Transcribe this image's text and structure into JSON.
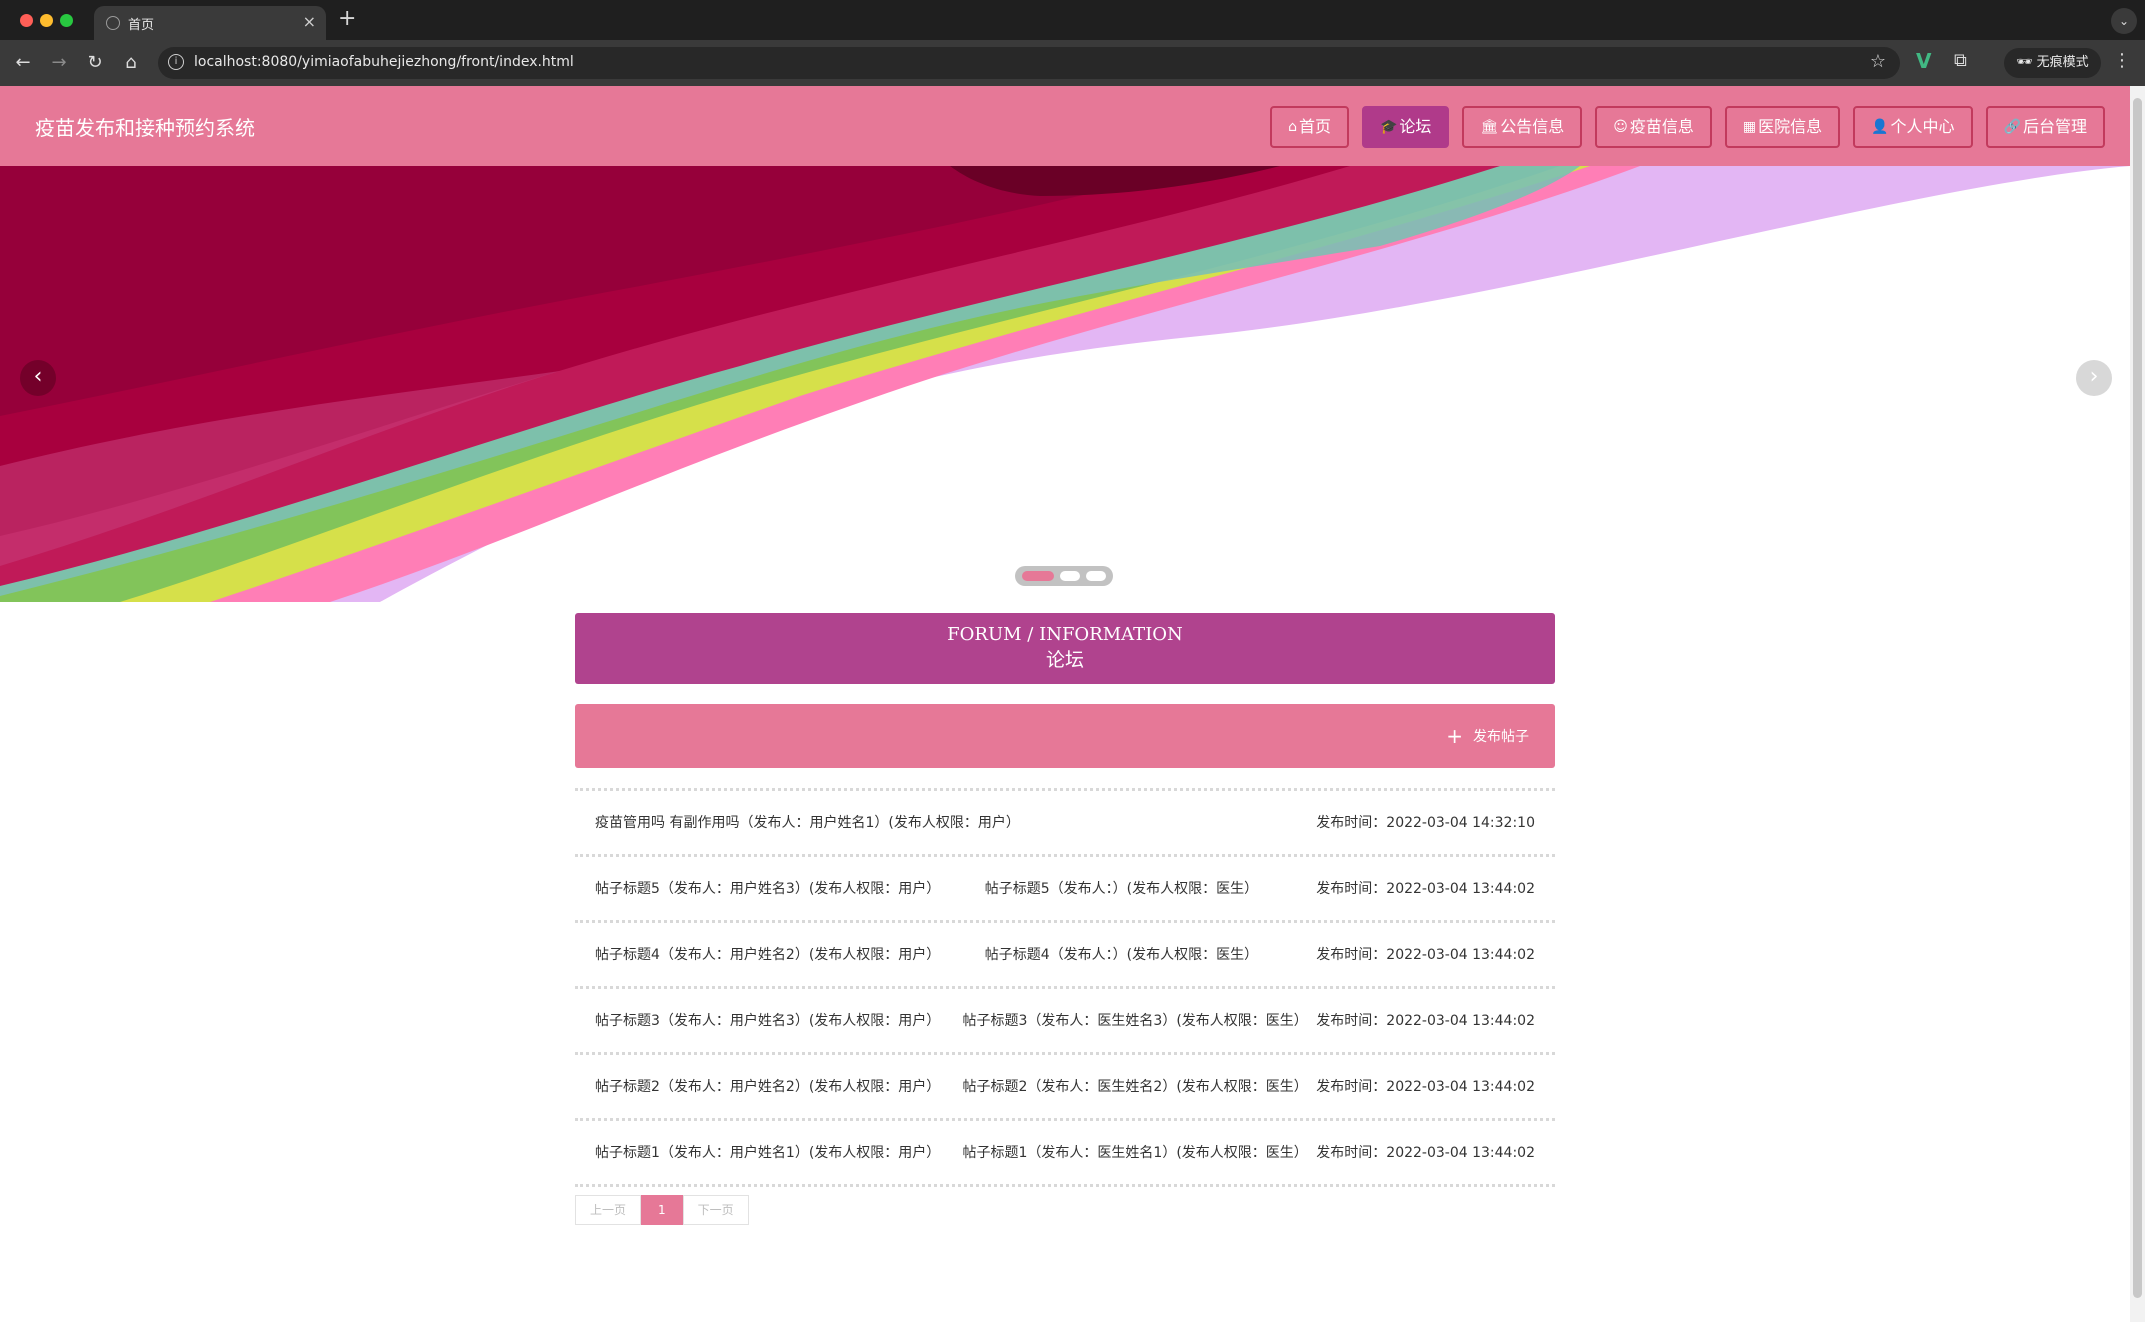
{
  "browser": {
    "tab_title": "首页",
    "url": "localhost:8080/yimiaofabuhejiezhong/front/index.html",
    "incognito_label": "无痕模式"
  },
  "site": {
    "title": "疫苗发布和接种预约系统",
    "nav": [
      {
        "label": "首页",
        "icon": "home-icon"
      },
      {
        "label": "论坛",
        "icon": "graduation-cap-icon",
        "active": true
      },
      {
        "label": "公告信息",
        "icon": "bank-icon"
      },
      {
        "label": "疫苗信息",
        "icon": "face-icon"
      },
      {
        "label": "医院信息",
        "icon": "hospital-icon"
      },
      {
        "label": "个人中心",
        "icon": "user-icon"
      },
      {
        "label": "后台管理",
        "icon": "link-icon"
      }
    ]
  },
  "banner": {
    "slide_count": 3,
    "active_index": 0
  },
  "forum": {
    "heading_en": "FORUM / INFORMATION",
    "heading_cn": "论坛",
    "publish_label": "发布帖子",
    "posts": [
      {
        "title": "疫苗管用吗 有副作用吗（发布人：用户姓名1）(发布人权限：用户）",
        "time": "发布时间：2022-03-04 14:32:10"
      },
      {
        "title": "帖子标题5（发布人：用户姓名3）(发布人权限：用户）          帖子标题5（发布人：）(发布人权限：医生）",
        "time": "发布时间：2022-03-04 13:44:02"
      },
      {
        "title": "帖子标题4（发布人：用户姓名2）(发布人权限：用户）          帖子标题4（发布人：）(发布人权限：医生）",
        "time": "发布时间：2022-03-04 13:44:02"
      },
      {
        "title": "帖子标题3（发布人：用户姓名3）(发布人权限：用户）     帖子标题3（发布人：医生姓名3）(发布人权限：医生）",
        "time": "发布时间：2022-03-04 13:44:02"
      },
      {
        "title": "帖子标题2（发布人：用户姓名2）(发布人权限：用户）     帖子标题2（发布人：医生姓名2）(发布人权限：医生）",
        "time": "发布时间：2022-03-04 13:44:02"
      },
      {
        "title": "帖子标题1（发布人：用户姓名1）(发布人权限：用户）     帖子标题1（发布人：医生姓名1）(发布人权限：医生）",
        "time": "发布时间：2022-03-04 13:44:02"
      }
    ],
    "pagination": {
      "prev_label": "上一页",
      "current_page": "1",
      "next_label": "下一页"
    }
  }
}
